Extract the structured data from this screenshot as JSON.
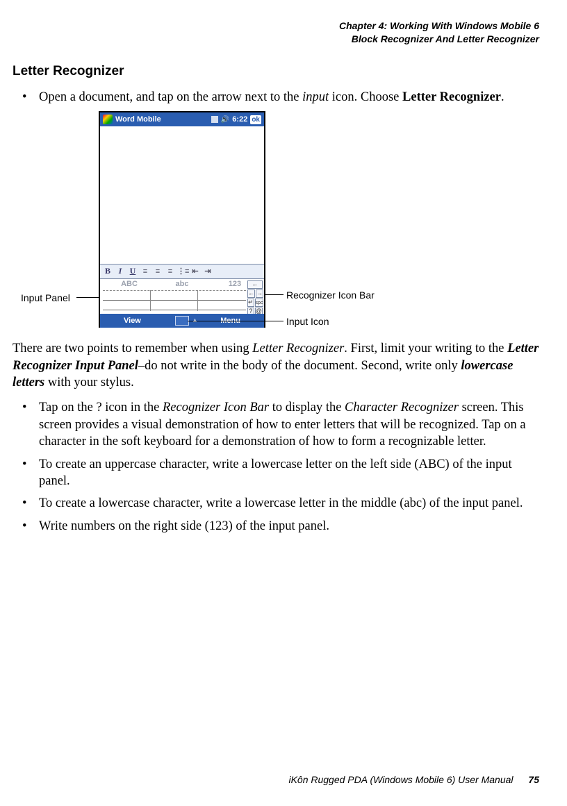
{
  "header": {
    "line1": "Chapter 4: Working With Windows Mobile 6",
    "line2": "Block Recognizer And Letter Recognizer"
  },
  "section_title": "Letter Recognizer",
  "intro_bullet": {
    "prefix": "Open a document, and tap on the arrow next to the ",
    "em1": "input",
    "mid": " icon. Choose ",
    "bold": "Letter Recognizer",
    "suffix": "."
  },
  "figure": {
    "app_title": "Word Mobile",
    "time": "6:22",
    "ok": "ok",
    "toolbar": {
      "b": "B",
      "i": "I",
      "u": "U"
    },
    "zones": {
      "abc_upper": "ABC",
      "abc_lower": "abc",
      "num": "123"
    },
    "iconbar": {
      "bksp": "←",
      "left": "←",
      "right": "→",
      "enter": "↵",
      "spc": "spc",
      "help": "?",
      "at": "@"
    },
    "bottom": {
      "view": "View",
      "menu": "Menu"
    },
    "callouts": {
      "input_panel": "Input Panel",
      "recognizer_bar": "Recognizer Icon Bar",
      "input_icon": "Input Icon"
    }
  },
  "para_after": {
    "t1": "There are two points to remember when using ",
    "em1": "Letter Recognizer",
    "t2": ". First, limit your writing to the ",
    "bem1": "Letter Recognizer Input Panel",
    "t3": "–do not write in the body of the document. Second, write only ",
    "bem2": "lowercase letters",
    "t4": " with your stylus."
  },
  "bullets": [
    {
      "t1": "Tap on the ? icon in the ",
      "em1": "Recognizer Icon Bar",
      "t2": " to display the ",
      "em2": "Character Recognizer",
      "t3": " screen. This screen provides a visual demonstration of how to enter letters that will be recognized. Tap on a character in the soft keyboard for a demonstration of how to form a recognizable letter."
    },
    {
      "plain": "To create an uppercase character, write a lowercase letter on the left side (ABC) of the input panel."
    },
    {
      "plain": "To create a lowercase character, write a lowercase letter in the middle (abc) of the input panel."
    },
    {
      "plain": "Write numbers on the right side (123) of the input panel."
    }
  ],
  "footer": {
    "text": "iKôn Rugged PDA (Windows Mobile 6) User Manual",
    "page": "75"
  }
}
